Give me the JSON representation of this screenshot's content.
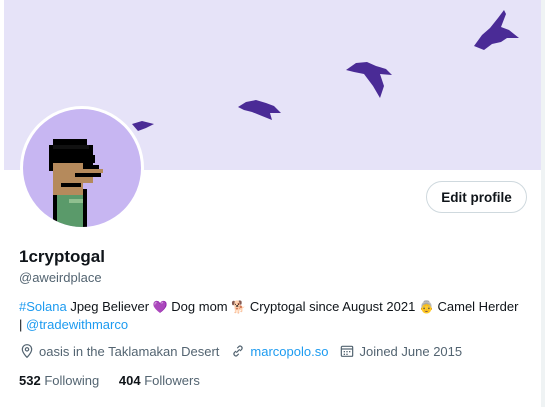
{
  "banner": {
    "bg_color": "#e6e3f8",
    "bird_color": "#4a2b96"
  },
  "avatar": {
    "bg_color": "#c7b6f2"
  },
  "edit_profile_label": "Edit profile",
  "profile": {
    "name": "1cryptogal",
    "handle": "@aweirdplace"
  },
  "bio": {
    "hashtag": "#Solana",
    "t1": " Jpeg Believer ",
    "e1": "💜",
    "t2": " Dog mom ",
    "e2": "🐕",
    "t3": " Cryptogal since August 2021 ",
    "e3": "👵",
    "t4": " Camel Herder | ",
    "mention": "@tradewithmarco"
  },
  "meta": {
    "location": "oasis in the Taklamakan Desert",
    "website": "marcopolo.so",
    "joined": "Joined June 2015"
  },
  "stats": {
    "following_count": "532",
    "following_label": "Following",
    "followers_count": "404",
    "followers_label": "Followers"
  }
}
